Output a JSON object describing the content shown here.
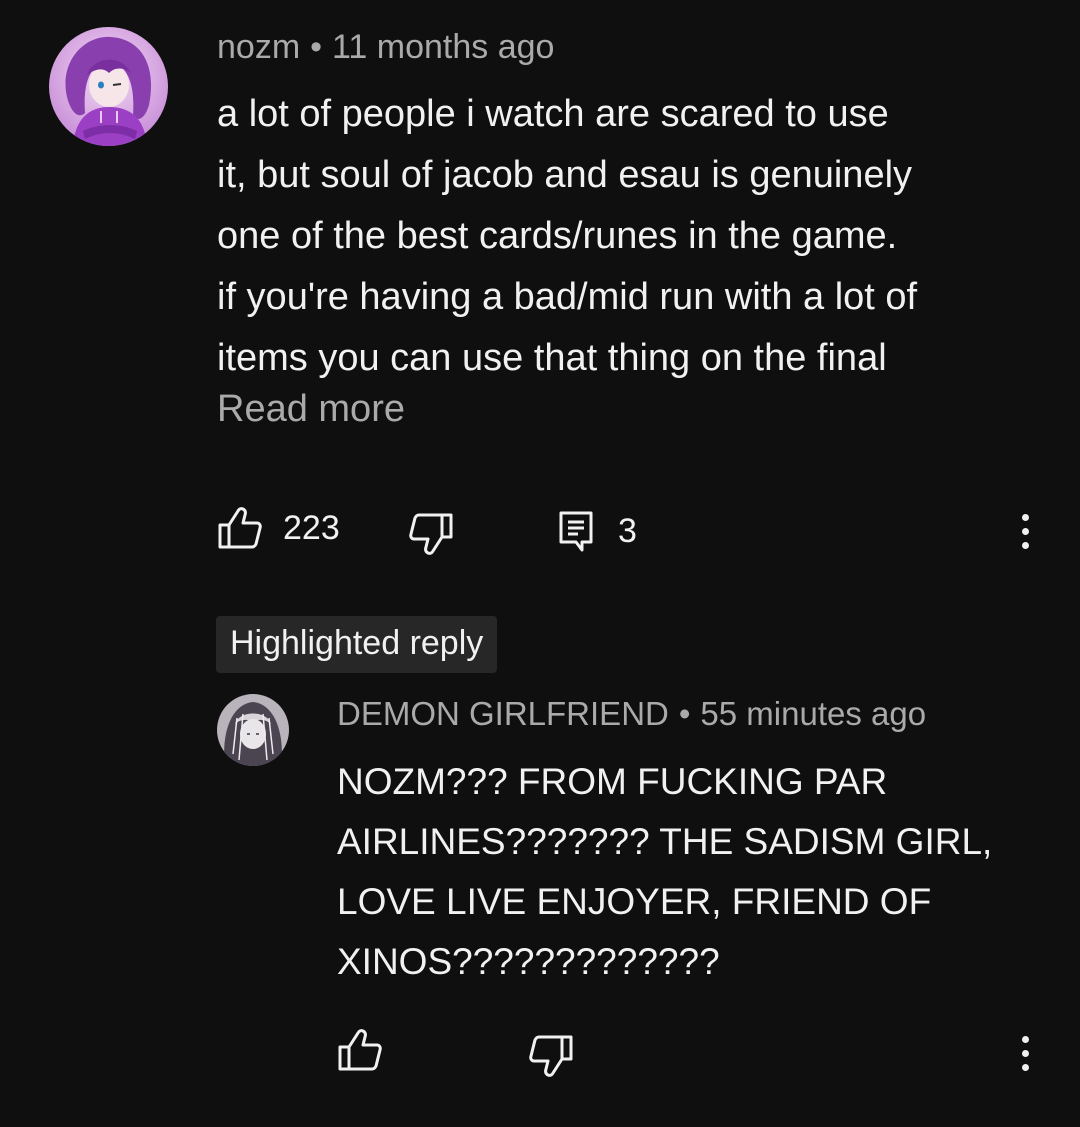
{
  "comment": {
    "author": "nozm",
    "separator": "•",
    "time": "11 months ago",
    "lines": [
      "a lot of people i watch are scared to use",
      "it, but soul of jacob and esau is genuinely",
      "one of the best cards/runes in the game.",
      "if you're having a bad/mid run with a lot of",
      "items you can use that thing on the final"
    ],
    "read_more": "Read more",
    "likes": "223",
    "replies": "3",
    "icons": {
      "avatar": "avatar-purple-hooded-character",
      "like": "thumbs-up-icon",
      "dislike": "thumbs-down-icon",
      "reply": "comment-icon",
      "menu": "more-vertical-icon"
    }
  },
  "highlight_badge": "Highlighted reply",
  "reply": {
    "author": "DEMON GIRLFRIEND",
    "separator": "•",
    "time": "55 minutes ago",
    "lines": [
      "NOZM??? FROM FUCKING PAR",
      "AIRLINES??????? THE SADISM GIRL,",
      "LOVE LIVE ENJOYER, FRIEND OF",
      "XINOS?????????????"
    ],
    "icons": {
      "avatar": "avatar-grayscale-anime",
      "like": "thumbs-up-icon",
      "dislike": "thumbs-down-icon",
      "menu": "more-vertical-icon"
    }
  },
  "colors": {
    "background": "#0f0f0f",
    "primary_text": "#f1f1f1",
    "secondary_text": "#aaaaaa",
    "badge_background": "#272727",
    "avatar_purple": "#8e44ad"
  }
}
